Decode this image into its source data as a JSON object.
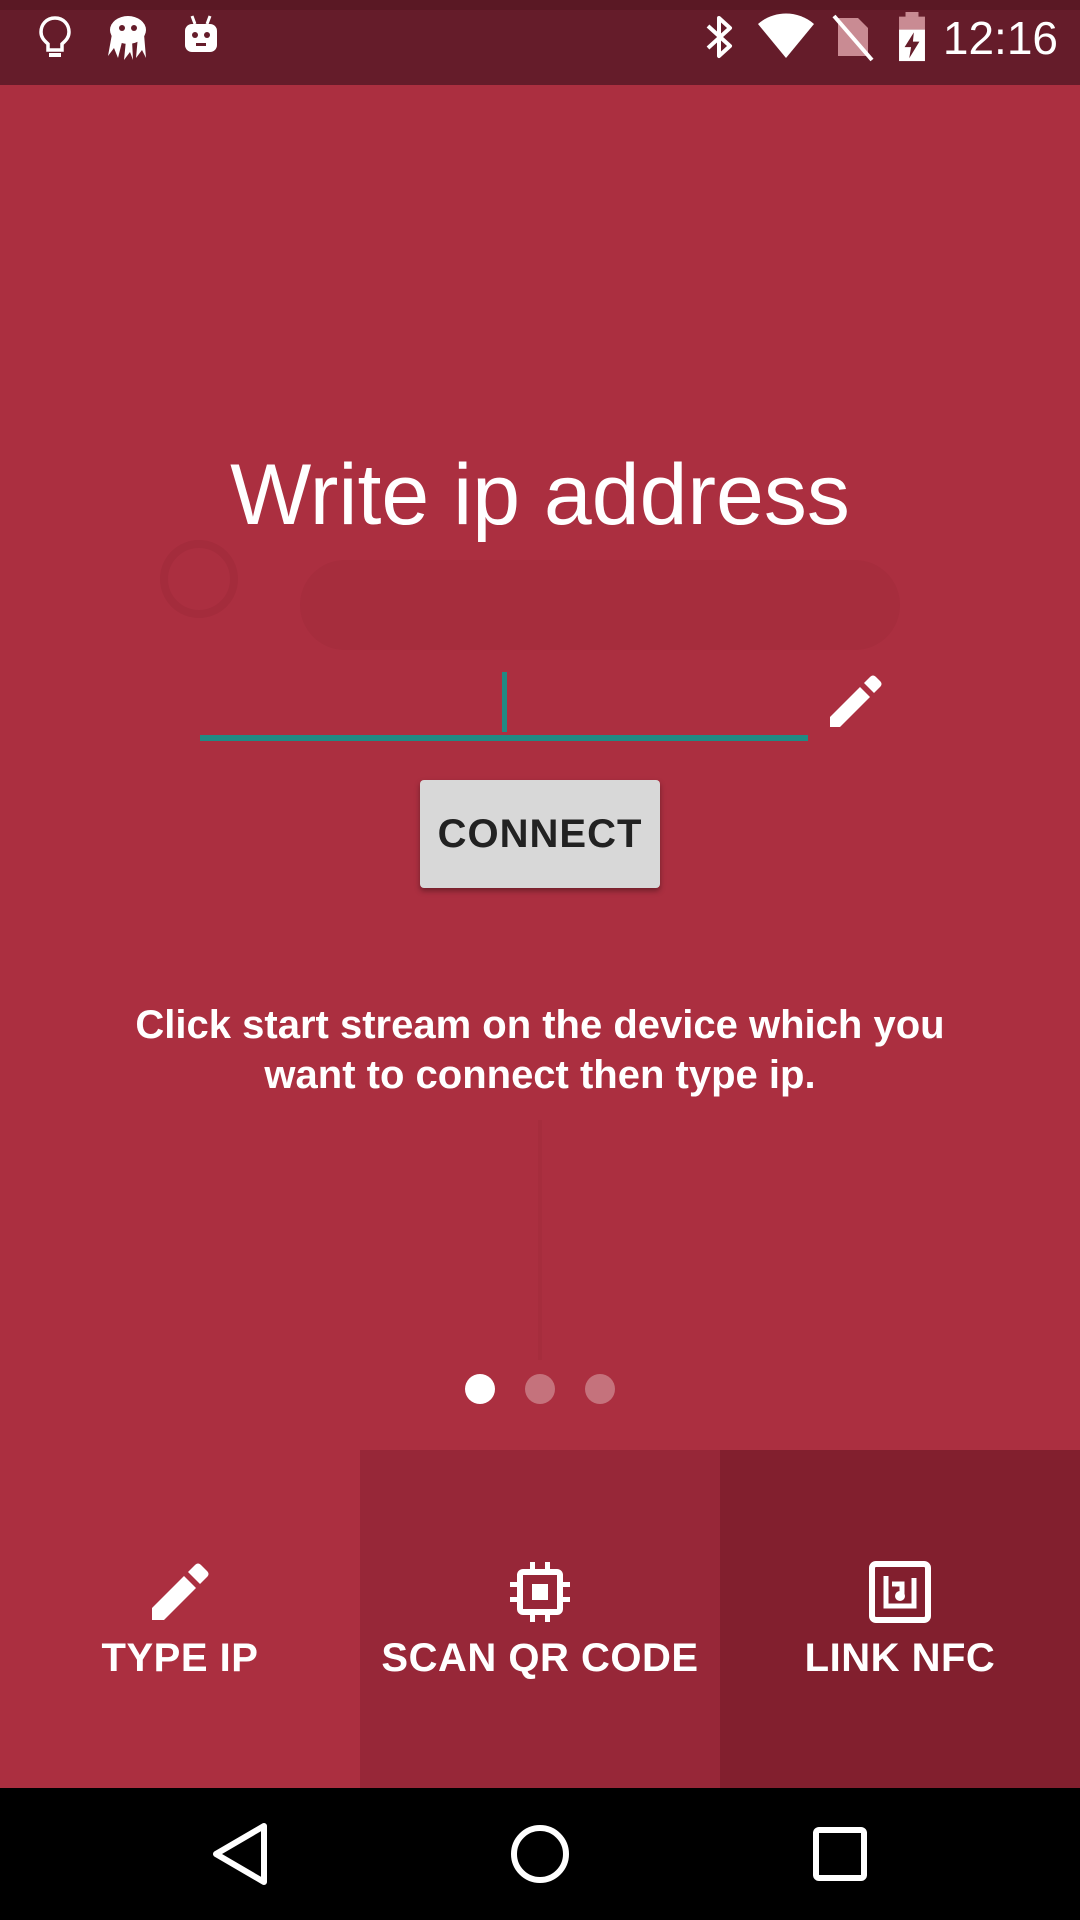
{
  "status_bar": {
    "time": "12:16",
    "left_icons": [
      "lightbulb-icon",
      "octopus-icon",
      "android-robot-icon"
    ],
    "right_icons": [
      "bluetooth-icon",
      "wifi-icon",
      "no-sim-icon",
      "battery-charging-icon"
    ]
  },
  "main": {
    "title": "Write ip address",
    "ip_input": {
      "value": "",
      "placeholder": ""
    },
    "connect_label": "CONNECT",
    "hint": "Click start stream on the device which you want to connect then type ip."
  },
  "pager": {
    "page_count": 3,
    "active_index": 0
  },
  "tabs": [
    {
      "label": "TYPE IP",
      "icon": "pencil-icon"
    },
    {
      "label": "SCAN QR CODE",
      "icon": "chip-icon"
    },
    {
      "label": "LINK NFC",
      "icon": "nfc-icon"
    }
  ],
  "nav_bar": {
    "buttons": [
      "back-icon",
      "home-icon",
      "recents-icon"
    ]
  },
  "colors": {
    "background": "#ab2f40",
    "status_bar": "#651c2a",
    "accent": "#1f8a84",
    "tab_2_bg": "#972738",
    "tab_3_bg": "#821f2e"
  }
}
